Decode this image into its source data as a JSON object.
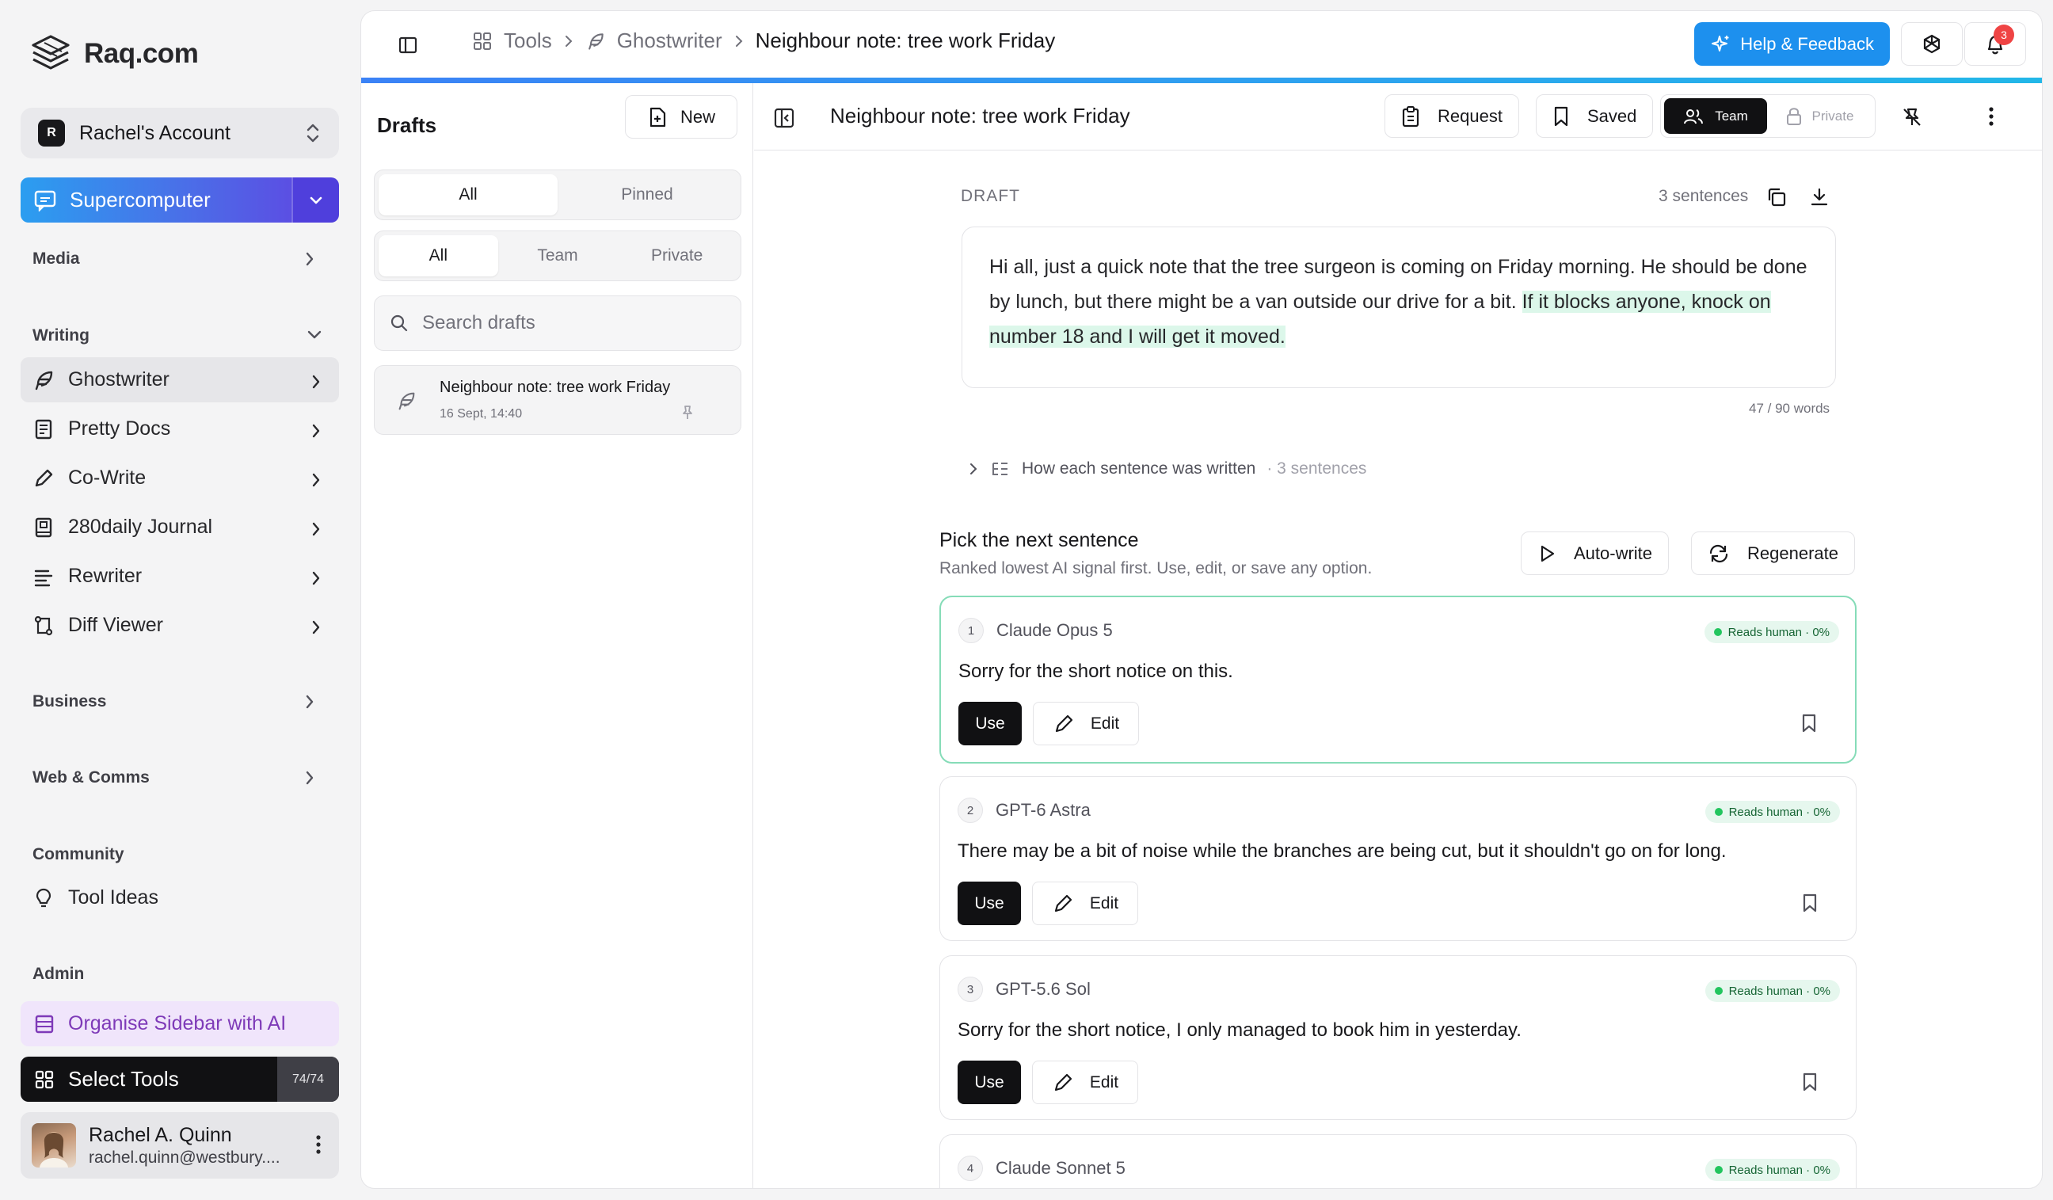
{
  "app": {
    "name": "Raq.com"
  },
  "account": {
    "initial": "R",
    "name": "Rachel's Account"
  },
  "supercomputer": {
    "label": "Supercomputer"
  },
  "sidebar": {
    "media": "Media",
    "writing": "Writing",
    "writing_items": [
      {
        "label": "Ghostwriter",
        "icon": "feather-icon"
      },
      {
        "label": "Pretty Docs",
        "icon": "doc-icon"
      },
      {
        "label": "Co-Write",
        "icon": "pen-icon"
      },
      {
        "label": "280daily Journal",
        "icon": "journal-icon"
      },
      {
        "label": "Rewriter",
        "icon": "lines-icon"
      },
      {
        "label": "Diff Viewer",
        "icon": "diff-icon"
      }
    ],
    "business": "Business",
    "web_comms": "Web & Comms",
    "community": "Community",
    "tool_ideas": "Tool Ideas",
    "admin": "Admin",
    "organise": "Organise Sidebar with AI",
    "select_tools": "Select Tools",
    "select_count": "74/74"
  },
  "user": {
    "name": "Rachel A. Quinn",
    "email": "rachel.quinn@westbury...."
  },
  "breadcrumb": {
    "tools": "Tools",
    "ghostwriter": "Ghostwriter",
    "current": "Neighbour note: tree work Friday"
  },
  "header": {
    "help": "Help & Feedback",
    "notifications": "3"
  },
  "drafts": {
    "title": "Drafts",
    "new": "New",
    "filter1": [
      "All",
      "Pinned"
    ],
    "filter2": [
      "All",
      "Team",
      "Private"
    ],
    "search_placeholder": "Search drafts",
    "items": [
      {
        "title": "Neighbour note: tree work Friday",
        "date": "16 Sept, 14:40"
      }
    ]
  },
  "editor": {
    "title": "Neighbour note: tree work Friday",
    "request": "Request",
    "saved": "Saved",
    "team": "Team",
    "private": "Private",
    "draft_label": "DRAFT",
    "sentence_count": "3 sentences",
    "text_plain": "Hi all, just a quick note that the tree surgeon is coming on Friday morning. He should be done by lunch, but there might be a van outside our drive for a bit. ",
    "text_highlight": "If it blocks anyone, knock on number 18 and I will get it moved.",
    "word_count": "47 / 90 words",
    "how_label": "How each sentence was written",
    "how_count": "· 3 sentences"
  },
  "pick": {
    "title": "Pick the next sentence",
    "subtitle": "Ranked lowest AI signal first. Use, edit, or save any option.",
    "autowrite": "Auto-write",
    "regenerate": "Regenerate",
    "use": "Use",
    "edit": "Edit",
    "options": [
      {
        "num": "1",
        "model": "Claude Opus 5",
        "signal": "Reads human · 0%",
        "text": "Sorry for the short notice on this."
      },
      {
        "num": "2",
        "model": "GPT-6 Astra",
        "signal": "Reads human · 0%",
        "text": "There may be a bit of noise while the branches are being cut, but it shouldn't go on for long."
      },
      {
        "num": "3",
        "model": "GPT-5.6 Sol",
        "signal": "Reads human · 0%",
        "text": "Sorry for the short notice, I only managed to book him in yesterday."
      },
      {
        "num": "4",
        "model": "Claude Sonnet 5",
        "signal": "Reads human · 0%",
        "text": ""
      }
    ]
  }
}
